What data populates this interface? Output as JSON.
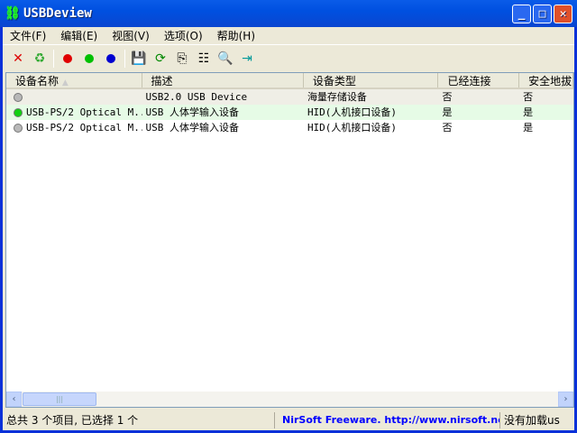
{
  "window": {
    "title": "USBDeview"
  },
  "menu": [
    "文件(F)",
    "编辑(E)",
    "视图(V)",
    "选项(O)",
    "帮助(H)"
  ],
  "toolbar": [
    {
      "icon": "delete-icon"
    },
    {
      "icon": "uninstall-icon"
    },
    {
      "icon": "red-dot-icon",
      "color": "#e00000"
    },
    {
      "icon": "green-dot-icon",
      "color": "#00c000"
    },
    {
      "icon": "blue-dot-icon",
      "color": "#0000d0"
    },
    {
      "icon": "save-icon"
    },
    {
      "icon": "refresh-icon"
    },
    {
      "icon": "copy-icon"
    },
    {
      "icon": "properties-icon"
    },
    {
      "icon": "find-icon"
    },
    {
      "icon": "exit-icon"
    }
  ],
  "columns": [
    "设备名称",
    "描述",
    "设备类型",
    "已经连接",
    "安全地拔"
  ],
  "rows": [
    {
      "status": "gray",
      "name": "",
      "desc": "USB2.0 USB Device",
      "type": "海量存储设备",
      "connected": "否",
      "safe": "否",
      "bg": "#efeee6"
    },
    {
      "status": "green",
      "name": "USB-PS/2 Optical M...",
      "desc": "USB 人体学输入设备",
      "type": "HID(人机接口设备)",
      "connected": "是",
      "safe": "是",
      "bg": "#e6fbe6"
    },
    {
      "status": "gray",
      "name": "USB-PS/2 Optical M...",
      "desc": "USB 人体学输入设备",
      "type": "HID(人机接口设备)",
      "connected": "否",
      "safe": "是",
      "bg": "#ffffff"
    }
  ],
  "status": {
    "summary": "总共 3 个项目, 已选择 1 个",
    "link": "NirSoft Freeware.  http://www.nirsoft.net",
    "right": "没有加载us",
    "link_color": "#0000ff"
  }
}
